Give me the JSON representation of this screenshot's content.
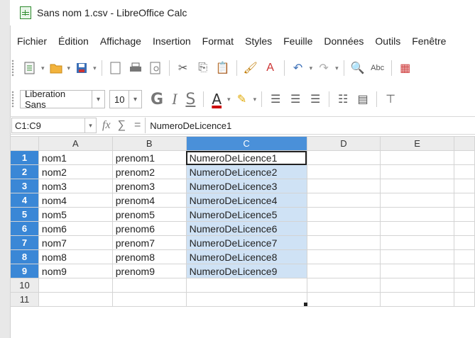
{
  "window": {
    "title": "Sans nom 1.csv - LibreOffice Calc"
  },
  "menu": [
    "Fichier",
    "Édition",
    "Affichage",
    "Insertion",
    "Format",
    "Styles",
    "Feuille",
    "Données",
    "Outils",
    "Fenêtre"
  ],
  "format_toolbar": {
    "font_name": "Liberation Sans",
    "font_size": "10",
    "bold": "G",
    "italic": "I",
    "underline": "S",
    "font_color": "A"
  },
  "formula_bar": {
    "name_box": "C1:C9",
    "fx": "fx",
    "sigma": "∑",
    "equals": "=",
    "content": "NumeroDeLicence1"
  },
  "sheet": {
    "columns": [
      "A",
      "B",
      "C",
      "D",
      "E"
    ],
    "rows": [
      {
        "n": "1",
        "a": "nom1",
        "b": "prenom1",
        "c": "NumeroDeLicence1"
      },
      {
        "n": "2",
        "a": "nom2",
        "b": "prenom2",
        "c": "NumeroDeLicence2"
      },
      {
        "n": "3",
        "a": "nom3",
        "b": "prenom3",
        "c": "NumeroDeLicence3"
      },
      {
        "n": "4",
        "a": "nom4",
        "b": "prenom4",
        "c": "NumeroDeLicence4"
      },
      {
        "n": "5",
        "a": "nom5",
        "b": "prenom5",
        "c": "NumeroDeLicence5"
      },
      {
        "n": "6",
        "a": "nom6",
        "b": "prenom6",
        "c": "NumeroDeLicence6"
      },
      {
        "n": "7",
        "a": "nom7",
        "b": "prenom7",
        "c": "NumeroDeLicence7"
      },
      {
        "n": "8",
        "a": "nom8",
        "b": "prenom8",
        "c": "NumeroDeLicence8"
      },
      {
        "n": "9",
        "a": "nom9",
        "b": "prenom9",
        "c": "NumeroDeLicence9"
      },
      {
        "n": "10",
        "a": "",
        "b": "",
        "c": ""
      },
      {
        "n": "11",
        "a": "",
        "b": "",
        "c": ""
      }
    ]
  },
  "colors": {
    "selection_header": "#4a90d9",
    "selection_fill": "#cfe2f5"
  }
}
